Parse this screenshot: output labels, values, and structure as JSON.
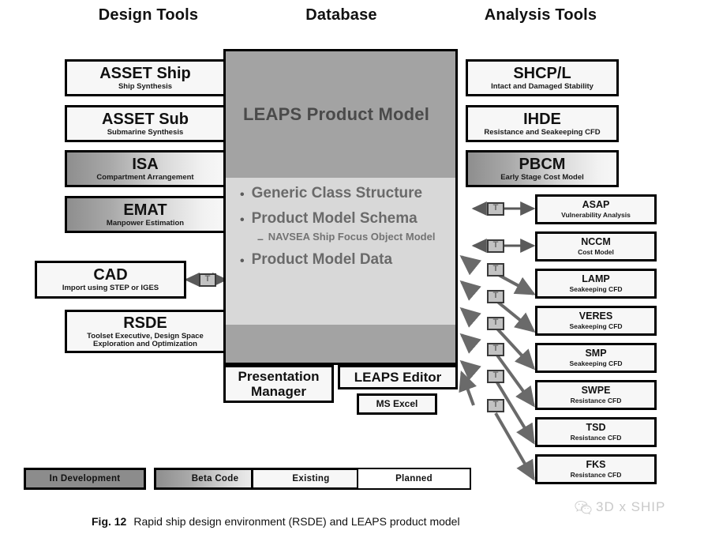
{
  "headers": {
    "design": "Design Tools",
    "database": "Database",
    "analysis": "Analysis Tools"
  },
  "design_tools": [
    {
      "title": "ASSET Ship",
      "subtitle": "Ship Synthesis",
      "status": "existing"
    },
    {
      "title": "ASSET Sub",
      "subtitle": "Submarine Synthesis",
      "status": "existing"
    },
    {
      "title": "ISA",
      "subtitle": "Compartment Arrangement",
      "status": "beta"
    },
    {
      "title": "EMAT",
      "subtitle": "Manpower Estimation",
      "status": "beta"
    },
    {
      "title": "CAD",
      "subtitle": "Import using STEP or IGES",
      "status": "existing"
    },
    {
      "title": "RSDE",
      "subtitle": "Toolset Executive, Design Space Exploration and Optimization",
      "status": "existing"
    }
  ],
  "database_panel": {
    "title": "LEAPS Product Model",
    "bullets": [
      {
        "text": "Generic Class Structure",
        "sub": null
      },
      {
        "text": "Product Model Schema",
        "sub": "NAVSEA Ship Focus Object Model"
      },
      {
        "text": "Product Model Data",
        "sub": null
      }
    ]
  },
  "database_bottom": [
    {
      "title": "Presentation Manager",
      "status": "existing"
    },
    {
      "title": "LEAPS Editor",
      "status": "existing"
    },
    {
      "title": "MS Excel",
      "status": "existing"
    }
  ],
  "analysis_tools_top": [
    {
      "title": "SHCP/L",
      "subtitle": "Intact and Damaged Stability",
      "status": "existing"
    },
    {
      "title": "IHDE",
      "subtitle": "Resistance and Seakeeping CFD",
      "status": "existing"
    },
    {
      "title": "PBCM",
      "subtitle": "Early Stage Cost Model",
      "status": "beta"
    }
  ],
  "analysis_tools_stack": [
    {
      "title": "ASAP",
      "subtitle": "Vulnerability Analysis",
      "status": "existing"
    },
    {
      "title": "NCCM",
      "subtitle": "Cost Model",
      "status": "existing"
    },
    {
      "title": "LAMP",
      "subtitle": "Seakeeping CFD",
      "status": "existing"
    },
    {
      "title": "VERES",
      "subtitle": "Seakeeping CFD",
      "status": "existing"
    },
    {
      "title": "SMP",
      "subtitle": "Seakeeping CFD",
      "status": "existing"
    },
    {
      "title": "SWPE",
      "subtitle": "Resistance CFD",
      "status": "existing"
    },
    {
      "title": "TSD",
      "subtitle": "Resistance CFD",
      "status": "existing"
    },
    {
      "title": "FKS",
      "subtitle": "Resistance CFD",
      "status": "existing"
    }
  ],
  "connectors": {
    "glyph": "T",
    "count_left": 1,
    "count_right": 7
  },
  "legend": [
    {
      "label": "In Development",
      "status": "indev"
    },
    {
      "label": "Beta Code",
      "status": "beta"
    },
    {
      "label": "Existing",
      "status": "existing"
    },
    {
      "label": "Planned",
      "status": "planned"
    }
  ],
  "caption": {
    "figure_number": "Fig. 12",
    "text": "Rapid ship design environment (RSDE) and LEAPS product model"
  },
  "watermark": {
    "text": "3D x SHIP",
    "icon": "wechat-icon"
  },
  "colors": {
    "panel_header": "#a3a3a3",
    "panel_body": "#d8d8d8",
    "in_development": "#8c8c8c",
    "border": "#000000",
    "connector_fill": "#c2c2c2",
    "arrow": "#6a6a6a",
    "watermark": "#c9c9c9"
  }
}
